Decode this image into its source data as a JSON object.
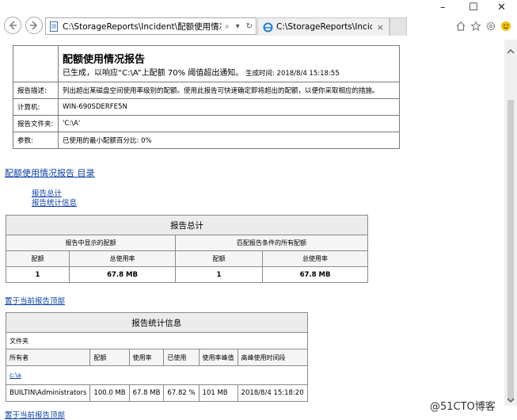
{
  "window": {
    "minimize": "–",
    "maximize": "☐",
    "close": "✕"
  },
  "nav": {
    "address": "C:\\StorageReports\\Incident\\配额使用情况",
    "search_glyph": "⌕",
    "dropdown_glyph": "▾",
    "refresh_glyph": "↻",
    "tab_title": "C:\\StorageReports\\Incid...",
    "tab_close": "×"
  },
  "report": {
    "title": "配额使用情况报告",
    "subtitle": "已生成，以响应“C:\\A”上配额 70% 阈值超出通知。",
    "generated": "生成时间: 2018/8/4 15:18:55",
    "rows": [
      {
        "label": "报告描述:",
        "value": "列出超出某磁盘空间使用率级别的配额。使用此报告可快速确定即将超出的配额，以便你采取相应的措施。"
      },
      {
        "label": "计算机:",
        "value": "WIN-690SDERFE5N"
      },
      {
        "label": "报告文件夹:",
        "value": "'C:\\A'"
      },
      {
        "label": "参数:",
        "value": "已使用的最小配额百分比: 0%"
      }
    ]
  },
  "toc": {
    "title": "配额使用情况报告 目录",
    "links": [
      "报告总计",
      "报告统计信息"
    ]
  },
  "summary": {
    "caption": "报告总计",
    "group_shown": "报告中显示的配额",
    "group_all": "匹配报告条件的所有配额",
    "columns": [
      "配额",
      "总使用率",
      "配额",
      "总使用率"
    ],
    "values": [
      "1",
      "67.8 MB",
      "1",
      "67.8 MB"
    ]
  },
  "back_to_top": "置于当前报告顶部",
  "stats": {
    "caption": "报告统计信息",
    "folder_label": "文件夹",
    "columns": [
      "所有者",
      "配额",
      "使用率",
      "已使用",
      "使用率峰值",
      "高峰使用时间段"
    ],
    "folder_link": "c:\\a",
    "row": [
      "BUILTIN\\Administrators",
      "100.0 MB",
      "67.8 MB",
      "67.82 %",
      "101 MB",
      "2018/8/4 15:18:20"
    ]
  },
  "watermark": "@51CTO博客"
}
